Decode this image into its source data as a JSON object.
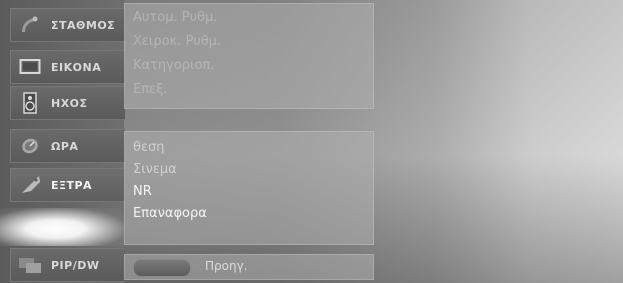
{
  "sidebar": {
    "items": [
      {
        "label": "ΣΤΑΘΜΟΣ",
        "icon": "satellite-dish-icon"
      },
      {
        "label": "ΕΙΚΟΝΑ",
        "icon": "picture-screen-icon"
      },
      {
        "label": "ΗΧΟΣ",
        "icon": "speaker-icon"
      },
      {
        "label": "ΩΡΑ",
        "icon": "clock-icon"
      },
      {
        "label": "ΕΞΤΡΑ",
        "icon": "tag-icon"
      },
      {
        "label": "PIP/DW",
        "icon": "pip-windows-icon"
      }
    ],
    "active_index": 4
  },
  "top_panel": {
    "lines": [
      "Αυτομ. Ρυθμ.",
      "Χειροκ. Ρυθμ.",
      "Κατηγοριοπ.",
      "Επεξ."
    ]
  },
  "main_panel": {
    "lines": [
      "θεση",
      "Σινεμα",
      "NR",
      "Επαναφορα"
    ]
  },
  "bottom_panel": {
    "prev_label": "Προηγ."
  }
}
